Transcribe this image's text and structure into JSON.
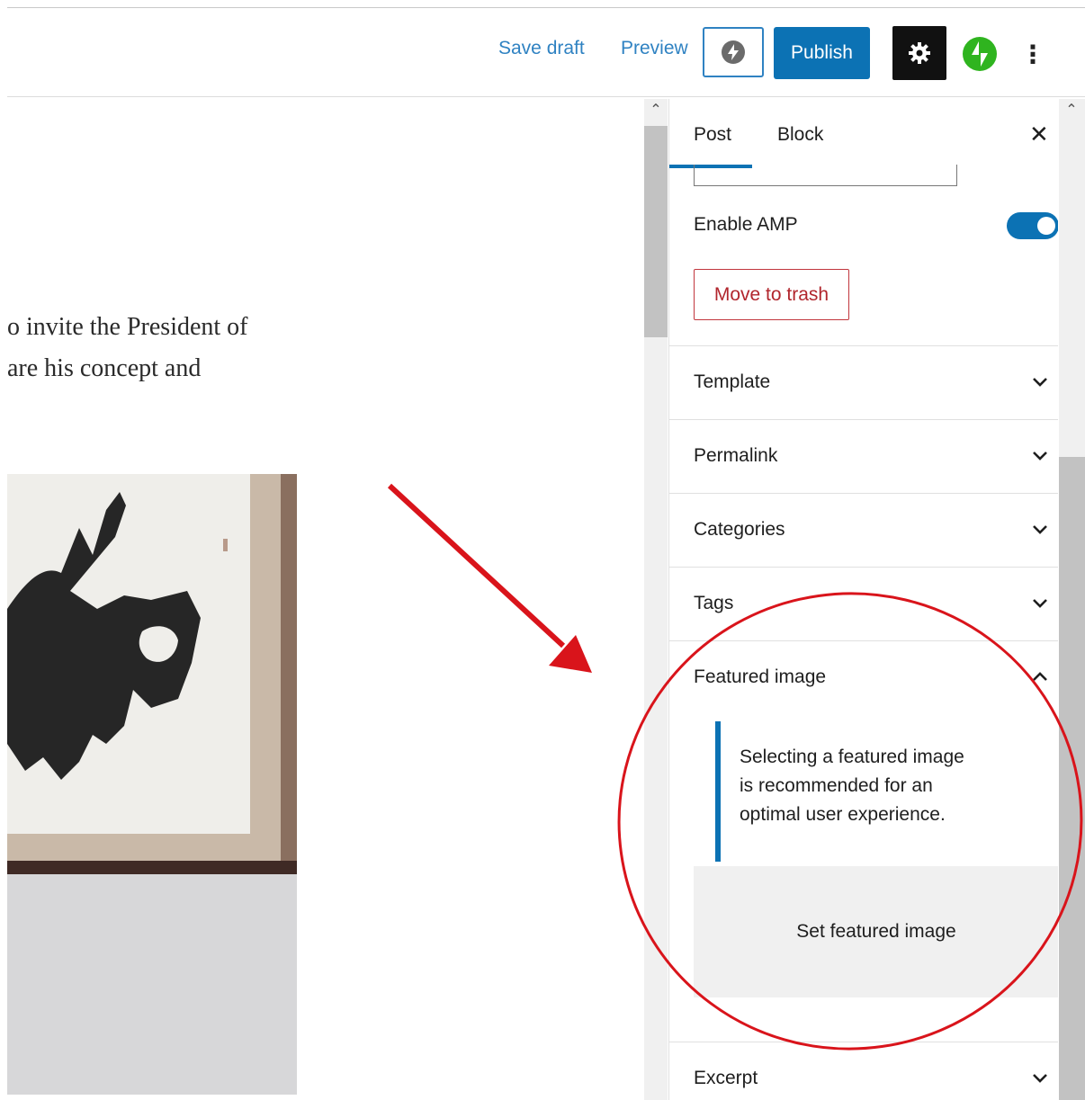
{
  "toolbar": {
    "save_draft": "Save draft",
    "preview": "Preview",
    "publish": "Publish",
    "more": "⋮"
  },
  "editor": {
    "line1": "o invite the President of",
    "line2": "are his concept and"
  },
  "sidebar": {
    "tabs": [
      "Post",
      "Block"
    ],
    "active_tab": "Post",
    "close": "✕",
    "enable_amp_label": "Enable AMP",
    "enable_amp_on": true,
    "move_to_trash": "Move to trash",
    "panels": [
      "Template",
      "Permalink",
      "Categories",
      "Tags",
      "Featured image",
      "Excerpt"
    ],
    "featured_image": {
      "notice_line1": "Selecting a featured image",
      "notice_line2": "is recommended for an",
      "notice_line3": "optimal user experience.",
      "button": "Set featured image"
    }
  },
  "colors": {
    "accent": "#0c72b4",
    "link": "#2f82c2",
    "danger": "#b1262d",
    "annotation": "#d9141b"
  }
}
